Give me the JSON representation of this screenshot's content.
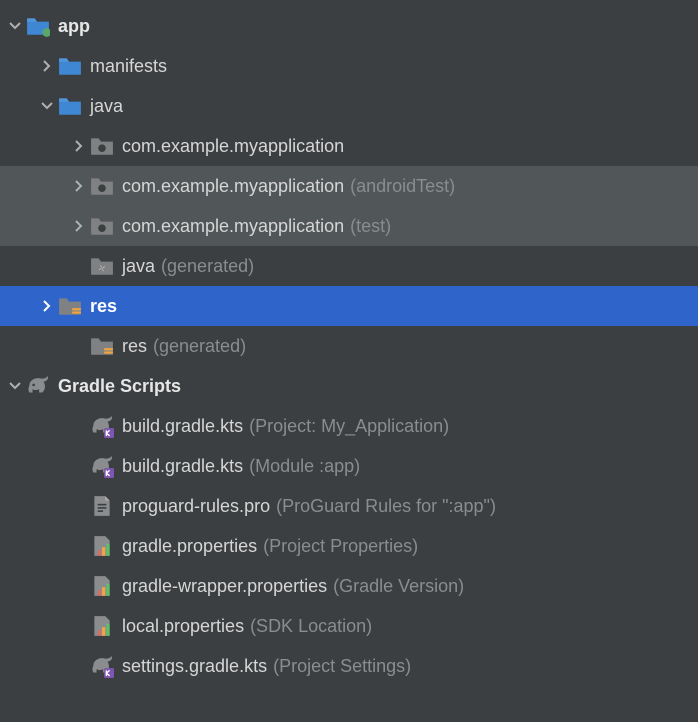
{
  "tree": {
    "app": {
      "label": "app",
      "manifests": {
        "label": "manifests"
      },
      "java": {
        "label": "java",
        "pkg_main": {
          "label": "com.example.myapplication"
        },
        "pkg_androidTest": {
          "label": "com.example.myapplication",
          "suffix": "(androidTest)"
        },
        "pkg_test": {
          "label": "com.example.myapplication",
          "suffix": "(test)"
        },
        "java_generated": {
          "label": "java",
          "suffix": "(generated)"
        }
      },
      "res": {
        "label": "res"
      },
      "res_generated": {
        "label": "res",
        "suffix": "(generated)"
      }
    },
    "gradle": {
      "label": "Gradle Scripts",
      "build_project": {
        "label": "build.gradle.kts",
        "suffix": "(Project: My_Application)"
      },
      "build_module": {
        "label": "build.gradle.kts",
        "suffix": "(Module :app)"
      },
      "proguard": {
        "label": "proguard-rules.pro",
        "suffix": "(ProGuard Rules for \":app\")"
      },
      "gradle_props": {
        "label": "gradle.properties",
        "suffix": "(Project Properties)"
      },
      "wrapper_props": {
        "label": "gradle-wrapper.properties",
        "suffix": "(Gradle Version)"
      },
      "local_props": {
        "label": "local.properties",
        "suffix": "(SDK Location)"
      },
      "settings": {
        "label": "settings.gradle.kts",
        "suffix": "(Project Settings)"
      }
    }
  }
}
